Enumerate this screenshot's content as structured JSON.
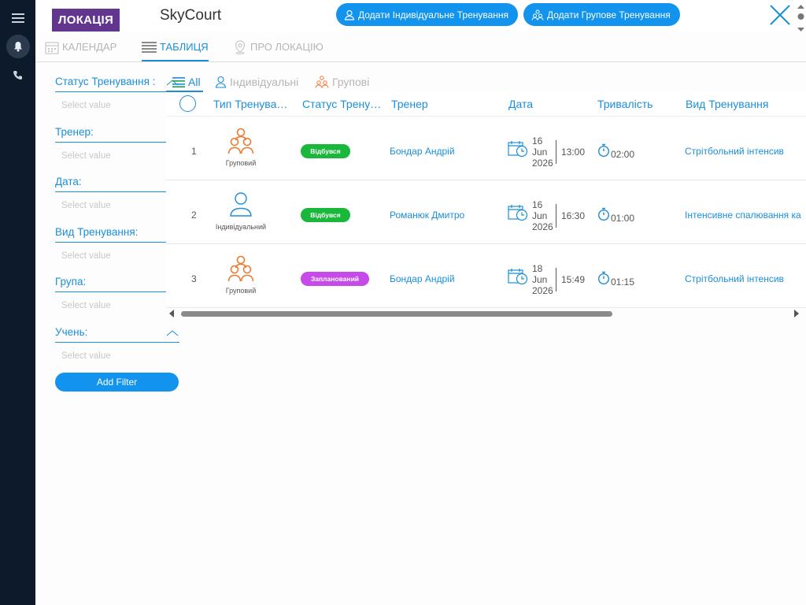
{
  "header": {
    "location_badge": "ЛОКАЦІЯ",
    "title": "SkyCourt",
    "add_individual": "Додати Індивідуальне Тренування",
    "add_group": "Додати Групове Тренування"
  },
  "tabs": {
    "calendar": "КАЛЕНДАР",
    "table": "ТАБЛИЦЯ",
    "about": "ПРО ЛОКАЦІЮ"
  },
  "filters": {
    "items": [
      {
        "label": "Статус Тренування :",
        "placeholder": "Select value"
      },
      {
        "label": "Тренер:",
        "placeholder": "Select value"
      },
      {
        "label": "Дата:",
        "placeholder": "Select value"
      },
      {
        "label": "Вид Тренування:",
        "placeholder": "Select value"
      },
      {
        "label": "Група:",
        "placeholder": "Select value"
      },
      {
        "label": "Учень:",
        "placeholder": "Select value"
      }
    ],
    "add_filter": "Add Filter"
  },
  "subtabs": {
    "all": "All",
    "individual": "Індивідуальні",
    "group": "Групові"
  },
  "table": {
    "columns": {
      "type": "Тип Тренува…",
      "status": "Статус Трену…",
      "trainer": "Тренер",
      "date": "Дата",
      "duration": "Тривалість",
      "kind": "Вид Тренування"
    },
    "rows": [
      {
        "num": "1",
        "type": "Груповий",
        "status": "Відбувся",
        "trainer": "Бондар Андрій",
        "day": "16",
        "month": "Jun",
        "year": "2026",
        "time": "13:00",
        "duration": "02:00",
        "kind": "Стрітбольний інтенсив"
      },
      {
        "num": "2",
        "type": "Індивідуальний",
        "status": "Відбувся",
        "trainer": "Романюк Дмитро",
        "day": "16",
        "month": "Jun",
        "year": "2026",
        "time": "16:30",
        "duration": "01:00",
        "kind": "Інтенсивне спалювання ка"
      },
      {
        "num": "3",
        "type": "Груповий",
        "status": "Запланований",
        "trainer": "Бондар Андрій",
        "day": "18",
        "month": "Jun",
        "year": "2026",
        "time": "15:49",
        "duration": "01:15",
        "kind": "Стрітбольний інтенсив"
      }
    ]
  },
  "colors": {
    "accent": "#1a8fd8",
    "status_done": "#19b83a",
    "status_planned": "#c64ae8",
    "location_badge": "#62358f",
    "group_icon": "#ee7a30",
    "rail": "#0d1a2b"
  }
}
